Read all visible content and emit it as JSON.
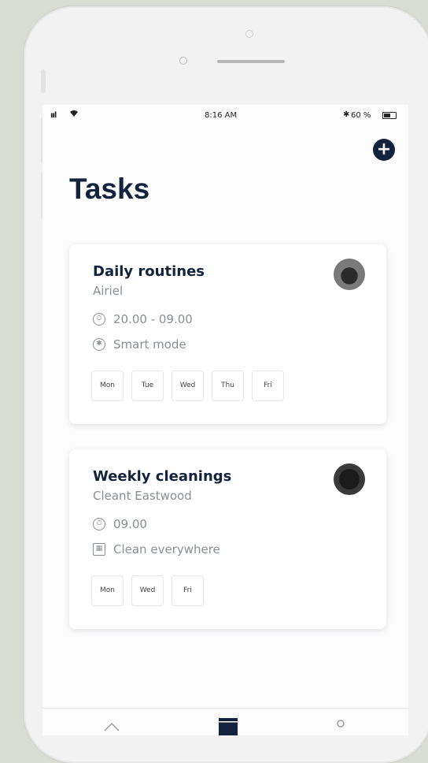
{
  "status_bar": {
    "signal": "ııl",
    "time": "8:16 AM",
    "battery_percent": "60 %",
    "battery_level": 0.6
  },
  "header": {
    "title": "Tasks",
    "add_icon": "plus-circle-icon"
  },
  "tasks": [
    {
      "title": "Daily routines",
      "owner": "Airiel",
      "time": "20.00 - 09.00",
      "time_icon": "clock-icon",
      "mode": "Smart mode",
      "mode_icon": "smart-mode-icon",
      "days": [
        "Mon",
        "Tue",
        "Wed",
        "Thu",
        "Fri"
      ]
    },
    {
      "title": "Weekly cleanings",
      "owner": "Cleant Eastwood",
      "time": "09.00",
      "time_icon": "clock-icon",
      "mode": "Clean everywhere",
      "mode_icon": "map-icon",
      "days": [
        "Mon",
        "Wed",
        "Fri"
      ]
    }
  ],
  "tab_bar": {
    "tabs": [
      {
        "icon": "home-icon"
      },
      {
        "icon": "calendar-icon"
      },
      {
        "icon": "profile-icon"
      }
    ]
  },
  "colors": {
    "brand_dark": "#13233d",
    "text_secondary": "#8a8e96"
  }
}
